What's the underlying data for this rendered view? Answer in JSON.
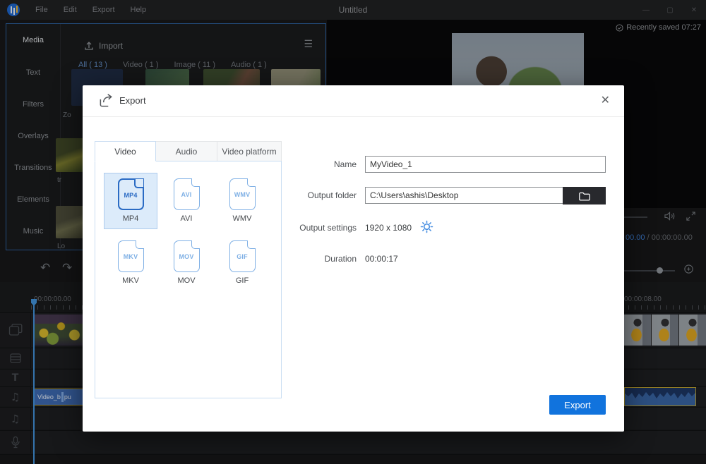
{
  "window": {
    "title": "Untitled",
    "menus": [
      "File",
      "Edit",
      "Export",
      "Help"
    ],
    "controls": {
      "minimize": "—",
      "maximize": "▢",
      "close": "✕"
    }
  },
  "sidebar": {
    "items": [
      "Media",
      "Text",
      "Filters",
      "Overlays",
      "Transitions",
      "Elements",
      "Music"
    ],
    "active_item": "Media"
  },
  "media_panel": {
    "import_label": "Import",
    "menu_icon": "☰",
    "tabs": [
      "All ( 13 )",
      "Video ( 1 )",
      "Image ( 11 )",
      "Audio ( 1 )"
    ],
    "active_tab": "All ( 13 )",
    "partial_item_labels": [
      "Zo",
      "tr",
      "Lo"
    ]
  },
  "preview": {
    "saved_status": "Recently saved 07:27",
    "time_current": "00.00",
    "time_rest": "/ 00:00:00.00"
  },
  "toolbar": {
    "undo_icon": "↶",
    "redo_icon": "↷"
  },
  "timeline": {
    "ruler_start": "00:00:00.00",
    "ruler_right": "00:00:08.00",
    "track_icons": {
      "text_track": "T",
      "audio_track": "♫",
      "music_track": "♫"
    },
    "audio_clip_label_left": "Video_b",
    "audio_clip_label_right": "pu"
  },
  "export_dialog": {
    "title": "Export",
    "close_icon": "✕",
    "tabs": [
      {
        "label": "Video",
        "active": true
      },
      {
        "label": "Audio",
        "active": false
      },
      {
        "label": "Video platform",
        "active": false
      }
    ],
    "formats": [
      {
        "label": "MP4",
        "selected": true
      },
      {
        "label": "AVI",
        "selected": false
      },
      {
        "label": "WMV",
        "selected": false
      },
      {
        "label": "MKV",
        "selected": false
      },
      {
        "label": "MOV",
        "selected": false
      },
      {
        "label": "GIF",
        "selected": false
      }
    ],
    "fields": {
      "name_label": "Name",
      "name_value": "MyVideo_1",
      "output_folder_label": "Output folder",
      "output_folder_value": "C:\\Users\\ashis\\Desktop",
      "output_settings_label": "Output settings",
      "output_settings_value": "1920 x 1080",
      "duration_label": "Duration",
      "duration_value": "00:00:17"
    },
    "export_button_label": "Export"
  },
  "colors": {
    "accent_blue": "#1173dd",
    "selected_format_blue": "#2a6bc4",
    "format_outline_blue": "#7fb0e5",
    "clip_border_yellow": "#b59a2e",
    "clip_blue": "#3a66ad",
    "playhead_blue": "#3f8fd6",
    "app_bg": "#141416",
    "dialog_bg": "#ffffff"
  }
}
